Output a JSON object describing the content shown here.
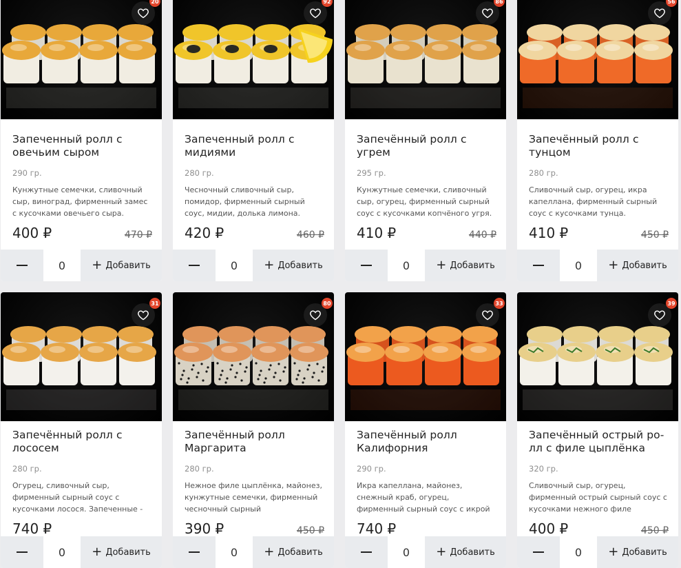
{
  "currency": "₽",
  "controls": {
    "add_label": "Добавить"
  },
  "products": [
    {
      "title": "Запеченный ролл с овечьим сыром",
      "weight": "290 гр.",
      "description": "Кунжутные семечки, сливочный сыр, виноград, фирменный замес с кусочками овечьего сыра.",
      "price": "400 ₽",
      "old_price": "470 ₽",
      "quantity": "0",
      "favorites": "20",
      "roll_color": "#f1ede2",
      "topping_color": "#e8a83a",
      "extra": "none"
    },
    {
      "title": "Запеченный ролл с мидиями",
      "weight": "280 гр.",
      "description": "Чесночный сливочный сыр, помидор, фирменный сырный соус, мидии, долька лимона.",
      "price": "420 ₽",
      "old_price": "460 ₽",
      "quantity": "0",
      "favorites": "92",
      "roll_color": "#f1ede2",
      "topping_color": "#f0c52a",
      "extra": "lemon"
    },
    {
      "title": "Запечённый ролл с угрем",
      "weight": "295 гр.",
      "description": "Кунжутные семечки, сливочный сыр, огурец, фирменный сырный соус с кусочками копчёного угря.",
      "price": "410 ₽",
      "old_price": "440 ₽",
      "quantity": "0",
      "favorites": "86",
      "roll_color": "#e9e2cf",
      "topping_color": "#e0a24a",
      "extra": "none"
    },
    {
      "title": "Запечённый ролл с тунцом",
      "weight": "280 гр.",
      "description": "Сливочный сыр, огурец, икра капеллана, фирменный сырный соус с кусочками тунца.",
      "price": "410 ₽",
      "old_price": "450 ₽",
      "quantity": "0",
      "favorites": "56",
      "roll_color": "#ef6a28",
      "topping_color": "#f0d6a0",
      "extra": "none"
    },
    {
      "title": "Запечённый ролл с лососем",
      "weight": "280 гр.",
      "description": "Огурец, сливочный сыр, фирменный сырный соус с кусочками лосося. Запеченные -",
      "price": "740 ₽",
      "old_price": "",
      "quantity": "0",
      "favorites": "31",
      "roll_color": "#f3f1ec",
      "topping_color": "#e6a647",
      "extra": "none"
    },
    {
      "title": "Запечённый ролл Маргарита",
      "weight": "280 гр.",
      "description": "Нежное филе цыплёнка, майонез, кунжутные семечки, фирменный чесночный сырный",
      "price": "390 ₽",
      "old_price": "450 ₽",
      "quantity": "0",
      "favorites": "80",
      "roll_color": "#d8d2c4",
      "topping_color": "#e0955a",
      "extra": "sesame"
    },
    {
      "title": "Запечённый ролл Калифорния",
      "weight": "290 гр.",
      "description": "Икра капеллана, майонез, снежный краб, огурец, фирменный сырный соус с икрой",
      "price": "740 ₽",
      "old_price": "",
      "quantity": "0",
      "favorites": "33",
      "roll_color": "#ec5a1f",
      "topping_color": "#f2a24a",
      "extra": "none"
    },
    {
      "title": "Запечённый острый ро- лл с филе цыплёнка",
      "weight": "320 гр.",
      "description": "Сливочный сыр, огурец, фирменный острый сырный соус с кусочками нежного филе",
      "price": "400 ₽",
      "old_price": "450 ₽",
      "quantity": "0",
      "favorites": "39",
      "roll_color": "#f3f1ea",
      "topping_color": "#e8cf8a",
      "extra": "herbs"
    }
  ]
}
